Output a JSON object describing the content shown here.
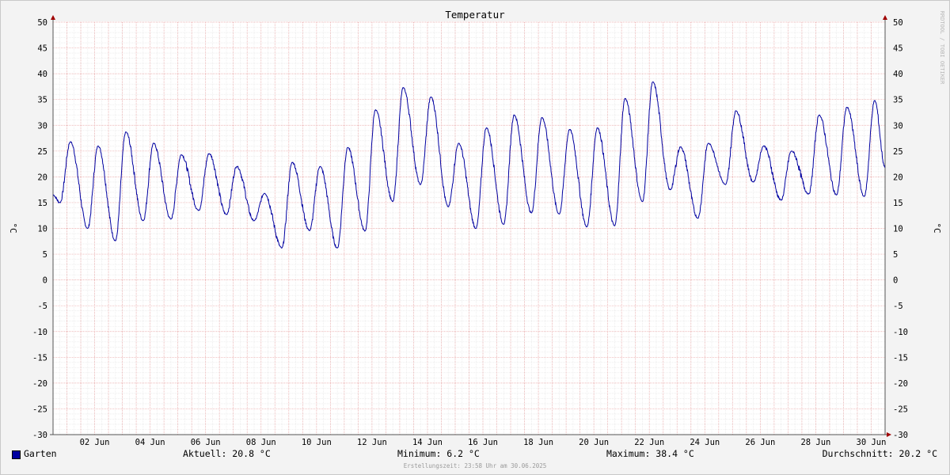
{
  "chart_data": {
    "type": "line",
    "title": "Temperatur",
    "ylabel": "°C",
    "ylim": [
      -30,
      50
    ],
    "yticks": [
      50,
      45,
      40,
      35,
      30,
      25,
      20,
      15,
      10,
      5,
      0,
      -5,
      -10,
      -15,
      -20,
      -25,
      -30
    ],
    "xlim": [
      "2025-06-01 00:00",
      "2025-07-01 00:00"
    ],
    "xticks": [
      "02 Jun",
      "04 Jun",
      "06 Jun",
      "08 Jun",
      "10 Jun",
      "12 Jun",
      "14 Jun",
      "16 Jun",
      "18 Jun",
      "20 Jun",
      "22 Jun",
      "24 Jun",
      "26 Jun",
      "28 Jun",
      "30 Jun"
    ],
    "grid": true,
    "series": [
      {
        "name": "Garten",
        "color": "#0000a0",
        "x": [
          "2025-06-01 00:00",
          "2025-06-01 06:00",
          "2025-06-01 15:00",
          "2025-06-02 06:00",
          "2025-06-02 15:00",
          "2025-06-03 06:00",
          "2025-06-03 15:00",
          "2025-06-04 06:00",
          "2025-06-04 15:00",
          "2025-06-05 06:00",
          "2025-06-05 15:00",
          "2025-06-06 06:00",
          "2025-06-06 15:00",
          "2025-06-07 06:00",
          "2025-06-07 15:00",
          "2025-06-08 06:00",
          "2025-06-08 15:00",
          "2025-06-09 06:00",
          "2025-06-09 15:00",
          "2025-06-10 06:00",
          "2025-06-10 15:00",
          "2025-06-11 06:00",
          "2025-06-11 15:00",
          "2025-06-12 06:00",
          "2025-06-12 15:00",
          "2025-06-13 06:00",
          "2025-06-13 15:00",
          "2025-06-14 06:00",
          "2025-06-14 15:00",
          "2025-06-15 06:00",
          "2025-06-15 15:00",
          "2025-06-16 06:00",
          "2025-06-16 15:00",
          "2025-06-17 06:00",
          "2025-06-17 15:00",
          "2025-06-18 06:00",
          "2025-06-18 15:00",
          "2025-06-19 06:00",
          "2025-06-19 15:00",
          "2025-06-20 06:00",
          "2025-06-20 15:00",
          "2025-06-21 06:00",
          "2025-06-21 15:00",
          "2025-06-22 06:00",
          "2025-06-22 15:00",
          "2025-06-23 06:00",
          "2025-06-23 15:00",
          "2025-06-24 06:00",
          "2025-06-24 15:00",
          "2025-06-25 06:00",
          "2025-06-25 15:00",
          "2025-06-26 06:00",
          "2025-06-26 15:00",
          "2025-06-27 06:00",
          "2025-06-27 15:00",
          "2025-06-28 06:00",
          "2025-06-28 15:00",
          "2025-06-29 06:00",
          "2025-06-29 15:00",
          "2025-06-30 06:00",
          "2025-06-30 15:00",
          "2025-06-30 23:58"
        ],
        "y": [
          16.5,
          15.0,
          26.8,
          10.0,
          26.0,
          7.6,
          28.7,
          11.5,
          26.5,
          11.8,
          24.3,
          13.5,
          24.5,
          12.7,
          22.0,
          11.5,
          16.8,
          6.2,
          22.8,
          9.6,
          22.0,
          6.2,
          25.7,
          9.5,
          33.0,
          15.2,
          37.3,
          18.5,
          35.5,
          14.2,
          26.5,
          10.0,
          29.5,
          10.8,
          32.0,
          13.0,
          31.5,
          12.8,
          29.2,
          10.3,
          29.5,
          10.5,
          35.2,
          15.2,
          38.4,
          17.5,
          25.8,
          12.0,
          26.5,
          18.5,
          32.8,
          19.0,
          26.0,
          15.5,
          25.0,
          16.7,
          32.0,
          16.5,
          33.5,
          16.2,
          34.8,
          21.9
        ]
      }
    ]
  },
  "legend": {
    "series_name": "Garten",
    "current": "Aktuell: 20.8 °C",
    "minimum": "Minimum: 6.2 °C",
    "maximum": "Maximum: 38.4 °C",
    "average": "Durchschnitt: 20.2 °C"
  },
  "footer": "Erstellungszeit: 23:58 Uhr am 30.06.2025",
  "watermark": "RRDTOOL / TOBI OETIKER"
}
